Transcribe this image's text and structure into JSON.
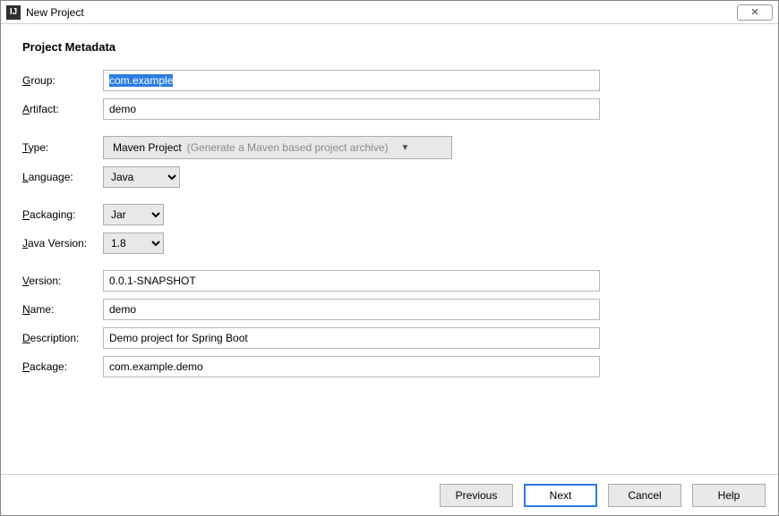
{
  "window": {
    "title": "New Project",
    "icon_letter": "IJ"
  },
  "section_title": "Project Metadata",
  "labels": {
    "group": "roup:",
    "artifact": "rtifact:",
    "type": "ype:",
    "language": "anguage:",
    "packaging": "ackaging:",
    "java_version": "ava Version:",
    "version": "ersion:",
    "name": "ame:",
    "description": "escription:",
    "package": "ackage:"
  },
  "mnemonics": {
    "group": "G",
    "artifact": "A",
    "type": "T",
    "language": "L",
    "packaging": "P",
    "java_version": "J",
    "version": "V",
    "name": "N",
    "description": "D",
    "package": "P"
  },
  "fields": {
    "group": "com.example",
    "artifact": "demo",
    "type_value": "Maven Project",
    "type_hint": "(Generate a Maven based project archive)",
    "language": "Java",
    "packaging": "Jar",
    "java_version": "1.8",
    "version": "0.0.1-SNAPSHOT",
    "name": "demo",
    "description": "Demo project for Spring Boot",
    "package": "com.example.demo"
  },
  "buttons": {
    "previous": "Previous",
    "next": "Next",
    "cancel": "Cancel",
    "help": "Help"
  }
}
